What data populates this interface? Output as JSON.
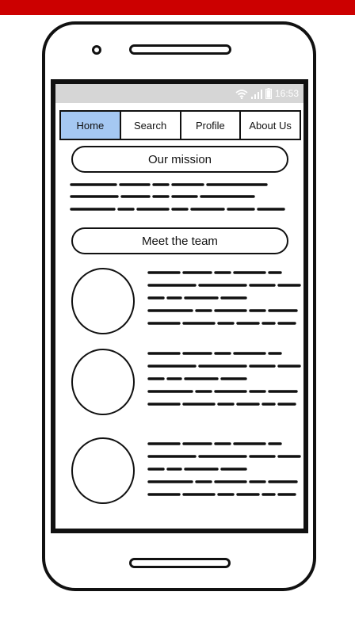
{
  "status_bar": {
    "time": "16:53",
    "icons": [
      "wifi-icon",
      "signal-icon",
      "battery-icon"
    ]
  },
  "nav": {
    "tabs": [
      {
        "label": "Home",
        "active": true
      },
      {
        "label": "Search",
        "active": false
      },
      {
        "label": "Profile",
        "active": false
      },
      {
        "label": "About Us",
        "active": false
      }
    ]
  },
  "sections": {
    "mission": {
      "title": "Our mission"
    },
    "team": {
      "title": "Meet the team"
    }
  },
  "colors": {
    "accent": "#cc0000",
    "active_tab": "#a5c8f2",
    "status_bar": "#d6d6d6",
    "ink": "#111111"
  }
}
